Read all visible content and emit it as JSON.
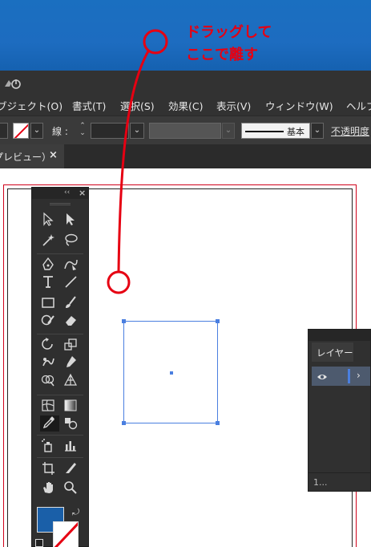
{
  "annotation": {
    "line1": "ドラッグして",
    "line2": "ここで離す",
    "color": "#e60012"
  },
  "menubar": {
    "items": [
      {
        "label": "ブジェクト(O)"
      },
      {
        "label": "書式(T)"
      },
      {
        "label": "選択(S)"
      },
      {
        "label": "効果(C)"
      },
      {
        "label": "表示(V)"
      },
      {
        "label": "ウィンドウ(W)"
      },
      {
        "label": "ヘルプ"
      }
    ]
  },
  "controlbar": {
    "stroke_label": "線 :",
    "brush_label": "基本",
    "opacity_label": "不透明度"
  },
  "document": {
    "tab_label": "プレビュー）",
    "close_glyph": "×"
  },
  "layers_panel": {
    "title": "レイヤー",
    "footer": "1..."
  },
  "tools_panel": {
    "collapse_glyph": "‹‹",
    "close_glyph": "×",
    "fill_color": "#1a5fa8",
    "tools": [
      "selection-tool",
      "direct-selection-tool",
      "magic-wand-tool",
      "lasso-tool",
      "pen-tool",
      "curvature-tool",
      "type-tool",
      "line-segment-tool",
      "rectangle-tool",
      "paintbrush-tool",
      "shaper-tool",
      "eraser-tool",
      "rotate-tool",
      "scale-tool",
      "warp-tool",
      "puppet-warp-tool",
      "shape-builder-tool",
      "perspective-grid-tool",
      "mesh-tool",
      "gradient-tool",
      "eyedropper-tool",
      "blend-tool",
      "symbol-sprayer-tool",
      "column-graph-tool",
      "artboard-tool",
      "slice-tool",
      "hand-tool",
      "zoom-tool"
    ]
  }
}
